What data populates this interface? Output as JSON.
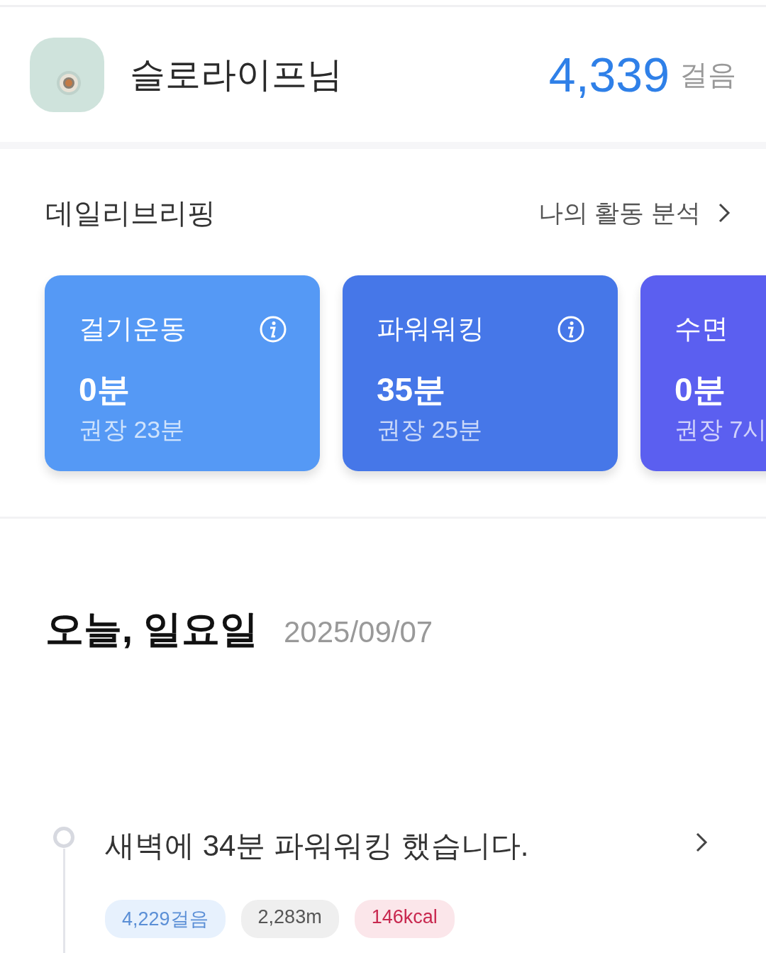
{
  "header": {
    "user_name": "슬로라이프님",
    "steps": "4,339",
    "steps_unit": "걸음"
  },
  "briefing": {
    "title": "데일리브리핑",
    "link": "나의 활동 분석",
    "cards": [
      {
        "title": "걸기운동",
        "value": "0분",
        "recommended": "권장 23분",
        "info": true,
        "color": "#5599f5"
      },
      {
        "title": "파워워킹",
        "value": "35분",
        "recommended": "권장 25분",
        "info": true,
        "color": "#4677e8"
      },
      {
        "title": "수면",
        "value": "0분",
        "recommended": "권장 7시",
        "color": "#5b5ff0"
      }
    ]
  },
  "day": {
    "title": "오늘, 일요일",
    "date": "2025/09/07"
  },
  "timeline": [
    {
      "text": "새벽에 34분 파워워킹 했습니다.",
      "tags": [
        {
          "label": "4,229걸음",
          "color": "#5b8fd6"
        },
        {
          "label": "2,283m",
          "color": "#555555"
        },
        {
          "label": "146kcal",
          "color": "#c8284f"
        }
      ]
    }
  ]
}
